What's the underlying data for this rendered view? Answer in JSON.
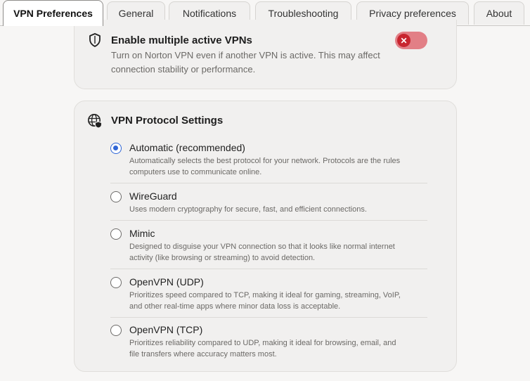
{
  "tabs": [
    {
      "label": "VPN Preferences",
      "active": true
    },
    {
      "label": "General"
    },
    {
      "label": "Notifications"
    },
    {
      "label": "Troubleshooting"
    },
    {
      "label": "Privacy preferences"
    },
    {
      "label": "About"
    }
  ],
  "multi_vpn": {
    "title": "Enable multiple active VPNs",
    "description_line1": "Turn on Norton VPN even if another VPN is active. This may affect",
    "description_line2": "connection stability or performance.",
    "toggle_glyph": "✕",
    "toggle_on": false,
    "icon": "shield-icon"
  },
  "protocol": {
    "title": "VPN Protocol Settings",
    "icon": "globe-shield-icon",
    "accent": "#2f66d6",
    "options": [
      {
        "label": "Automatic (recommended)",
        "checked": true,
        "desc1": "Automatically selects the best protocol for your network. Protocols are the rules",
        "desc2": "computers use to communicate online."
      },
      {
        "label": "WireGuard",
        "checked": false,
        "desc1": "Uses modern cryptography for secure, fast, and efficient connections.",
        "desc2": ""
      },
      {
        "label": "Mimic",
        "checked": false,
        "desc1": "Designed to disguise your VPN connection so that it looks like normal internet",
        "desc2": "activity (like browsing or streaming) to avoid detection."
      },
      {
        "label": "OpenVPN (UDP)",
        "checked": false,
        "desc1": "Prioritizes speed compared to TCP, making it ideal for gaming, streaming, VoIP,",
        "desc2": "and other real-time apps where minor data loss is acceptable."
      },
      {
        "label": "OpenVPN (TCP)",
        "checked": false,
        "desc1": "Prioritizes reliability compared to UDP, making it ideal for browsing, email, and",
        "desc2": "file transfers where accuracy matters most."
      }
    ]
  }
}
